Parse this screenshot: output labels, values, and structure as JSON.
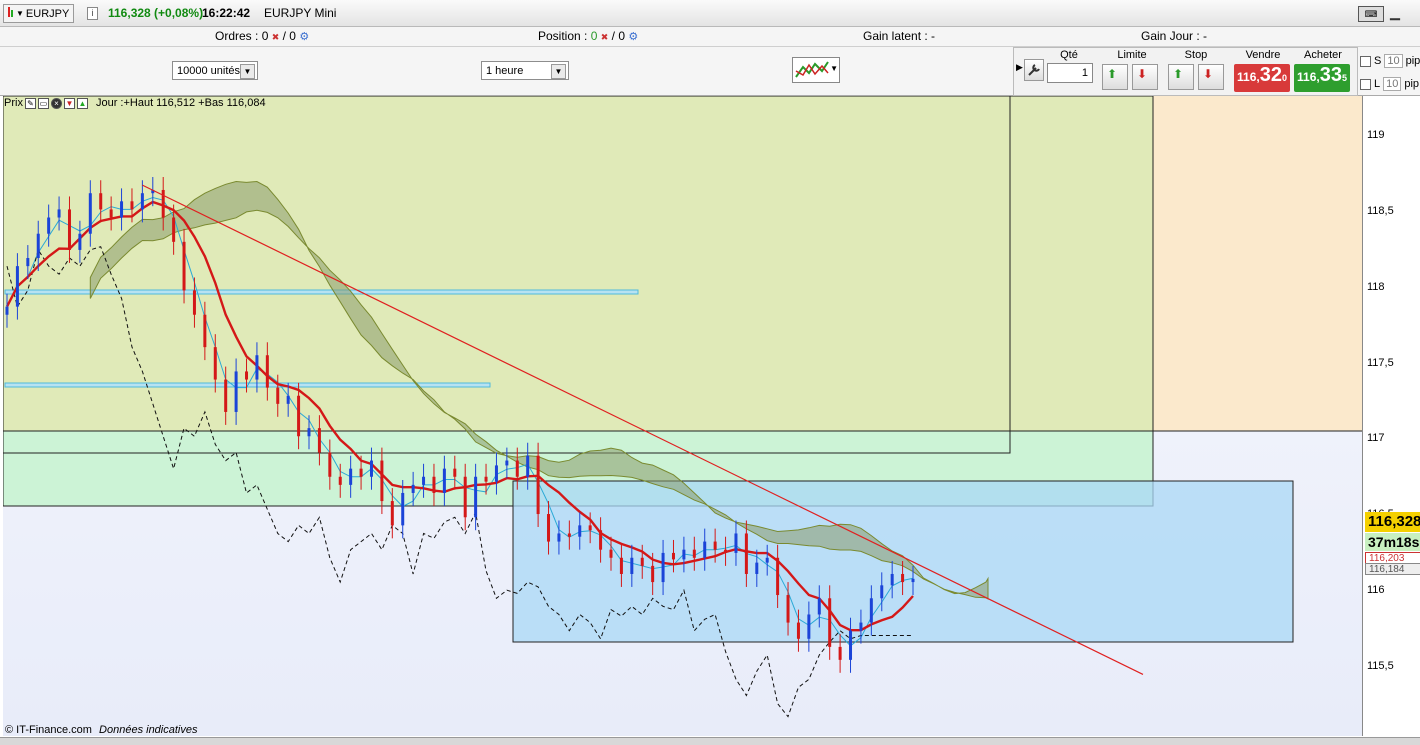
{
  "titlebar": {
    "symbol": "EURJPY",
    "quote": "116,328 (+0,08%)",
    "clock": "16:22:42",
    "instrument": "EURJPY Mini"
  },
  "orders_row": {
    "orders_label": "Ordres :",
    "orders_value1": "0",
    "orders_value2": "0",
    "position_label": "Position :",
    "position_value1": "0",
    "position_value2": "0",
    "gain_latent": "Gain latent : -",
    "gain_jour": "Gain Jour : -"
  },
  "toolbar": {
    "units_select": "10000 unités",
    "period_select": "1 heure"
  },
  "trade_panel": {
    "qte_label": "Qté",
    "qte_value": "1",
    "limite_label": "Limite",
    "stop_label": "Stop",
    "vendre_label": "Vendre",
    "acheter_label": "Acheter",
    "sell_prefix": "116,",
    "sell_big": "32",
    "sell_sup": "0",
    "buy_prefix": "116,",
    "buy_big": "33",
    "buy_sup": "5",
    "s_label": "S",
    "l_label": "L",
    "s_pips": "10",
    "l_pips": "10",
    "pips_label": "pip",
    "sell_color": "#d83a3a",
    "buy_color": "#2e9e2e"
  },
  "chart_header": {
    "prix_label": "Prix",
    "day_info": "Jour :+Haut 116,512 +Bas 116,084"
  },
  "yaxis": {
    "ticks": [
      "119",
      "118,5",
      "118",
      "117,5",
      "117",
      "116,5",
      "116",
      "115,5"
    ],
    "current_price": "116,328",
    "countdown": "37m18s",
    "level_a": "116,203",
    "level_b": "116,184"
  },
  "footer": {
    "copyright": "© IT-Finance.com",
    "note": "Données indicatives"
  },
  "chart_data": {
    "type": "line",
    "instrument": "EURJPY",
    "timeframe": "1 heure",
    "ylim": [
      115.35,
      119.3
    ],
    "close": [
      118.0,
      118.25,
      118.3,
      118.45,
      118.55,
      118.6,
      118.35,
      118.45,
      118.7,
      118.6,
      118.55,
      118.65,
      118.6,
      118.7,
      118.72,
      118.55,
      118.4,
      118.1,
      117.95,
      117.75,
      117.55,
      117.35,
      117.6,
      117.55,
      117.7,
      117.5,
      117.4,
      117.45,
      117.2,
      117.25,
      117.1,
      116.95,
      116.9,
      117.0,
      116.95,
      117.05,
      116.8,
      116.65,
      116.85,
      116.9,
      116.95,
      116.85,
      117.0,
      116.95,
      116.7,
      116.95,
      116.92,
      117.02,
      117.05,
      116.95,
      117.08,
      116.72,
      116.55,
      116.6,
      116.58,
      116.65,
      116.62,
      116.5,
      116.45,
      116.35,
      116.45,
      116.4,
      116.3,
      116.48,
      116.44,
      116.5,
      116.45,
      116.55,
      116.5,
      116.48,
      116.6,
      116.35,
      116.42,
      116.45,
      116.22,
      116.05,
      115.95,
      116.1,
      116.2,
      115.9,
      115.82,
      116.0,
      116.05,
      116.2,
      116.28,
      116.35,
      116.3,
      116.32
    ]
  }
}
